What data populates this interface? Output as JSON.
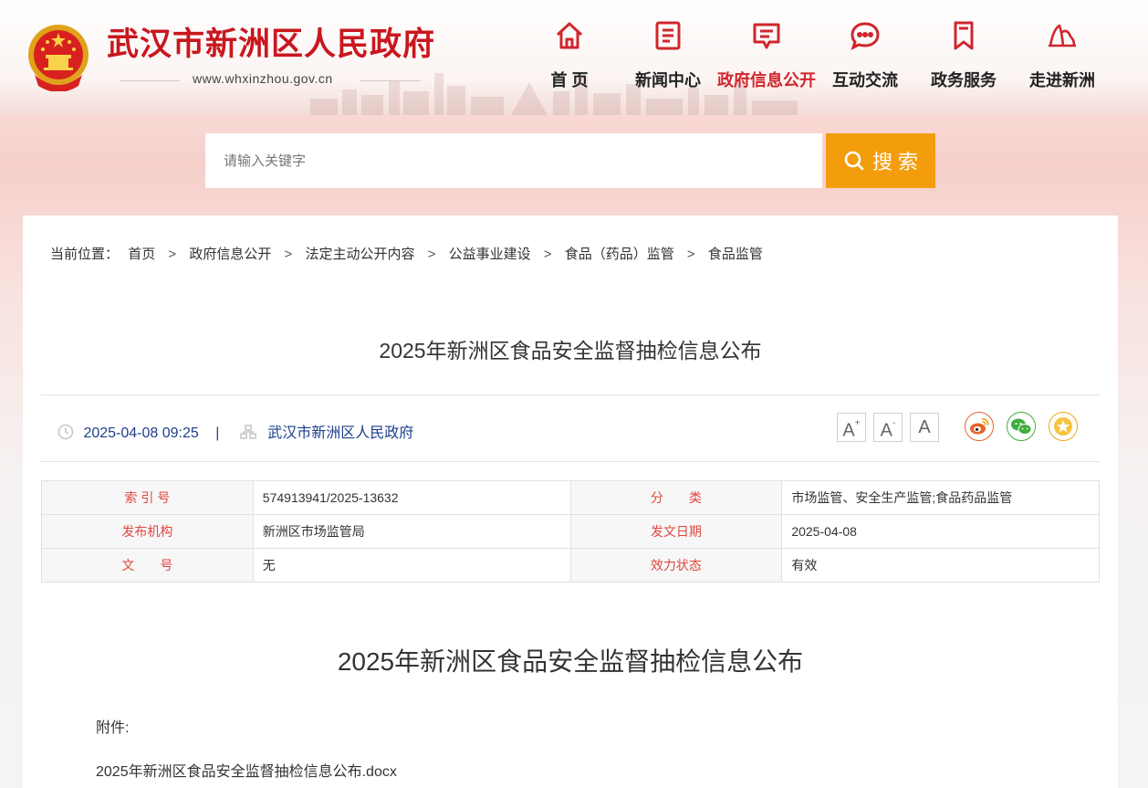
{
  "header": {
    "site_title": "武汉市新洲区人民政府",
    "site_url": "www.whxinzhou.gov.cn",
    "nav": [
      {
        "label": "首 页",
        "icon": "home-icon",
        "active": false
      },
      {
        "label": "新闻中心",
        "icon": "news-icon",
        "active": false
      },
      {
        "label": "政府信息公开",
        "icon": "info-disclosure-icon",
        "active": true
      },
      {
        "label": "互动交流",
        "icon": "chat-icon",
        "active": false
      },
      {
        "label": "政务服务",
        "icon": "bookmark-icon",
        "active": false
      },
      {
        "label": "走进新洲",
        "icon": "landmark-icon",
        "active": false
      }
    ],
    "accent_color": "#c9171e"
  },
  "search": {
    "placeholder": "请输入关键字",
    "value": "",
    "button_label": "搜 索",
    "button_color": "#f39d0d"
  },
  "breadcrumb": {
    "prefix": "当前位置：",
    "items": [
      "首页",
      "政府信息公开",
      "法定主动公开内容",
      "公益事业建设",
      "食品（药品）监管",
      "食品监管"
    ],
    "separator": ">"
  },
  "article": {
    "title": "2025年新洲区食品安全监督抽检信息公布",
    "date": "2025-04-08 09:25",
    "pipe": "|",
    "source": "武汉市新洲区人民政府",
    "font_size_buttons": [
      {
        "label": "A",
        "mark": "+",
        "name": "font-increase-button"
      },
      {
        "label": "A",
        "mark": "-",
        "name": "font-decrease-button"
      },
      {
        "label": "A",
        "mark": "",
        "name": "font-default-button"
      }
    ],
    "share": [
      {
        "icon": "weibo-icon",
        "color": "#e8632b"
      },
      {
        "icon": "wechat-icon",
        "color": "#3fae3f"
      },
      {
        "icon": "favorite-star-icon",
        "color": "#f0a51c"
      }
    ]
  },
  "info_table": {
    "rows": [
      {
        "k1": "索 引 号",
        "v1": "574913941/2025-13632",
        "k2": "分　　类",
        "v2": "市场监管、安全生产监管;食品药品监管"
      },
      {
        "k1": "发布机构",
        "v1": "新洲区市场监管局",
        "k2": "发文日期",
        "v2": "2025-04-08"
      },
      {
        "k1": "文　　号",
        "v1": "无",
        "k2": "效力状态",
        "v2": "有效"
      }
    ]
  },
  "content": {
    "title": "2025年新洲区食品安全监督抽检信息公布",
    "attachment_label": "附件:",
    "attachment_file": "2025年新洲区食品安全监督抽检信息公布.docx"
  }
}
